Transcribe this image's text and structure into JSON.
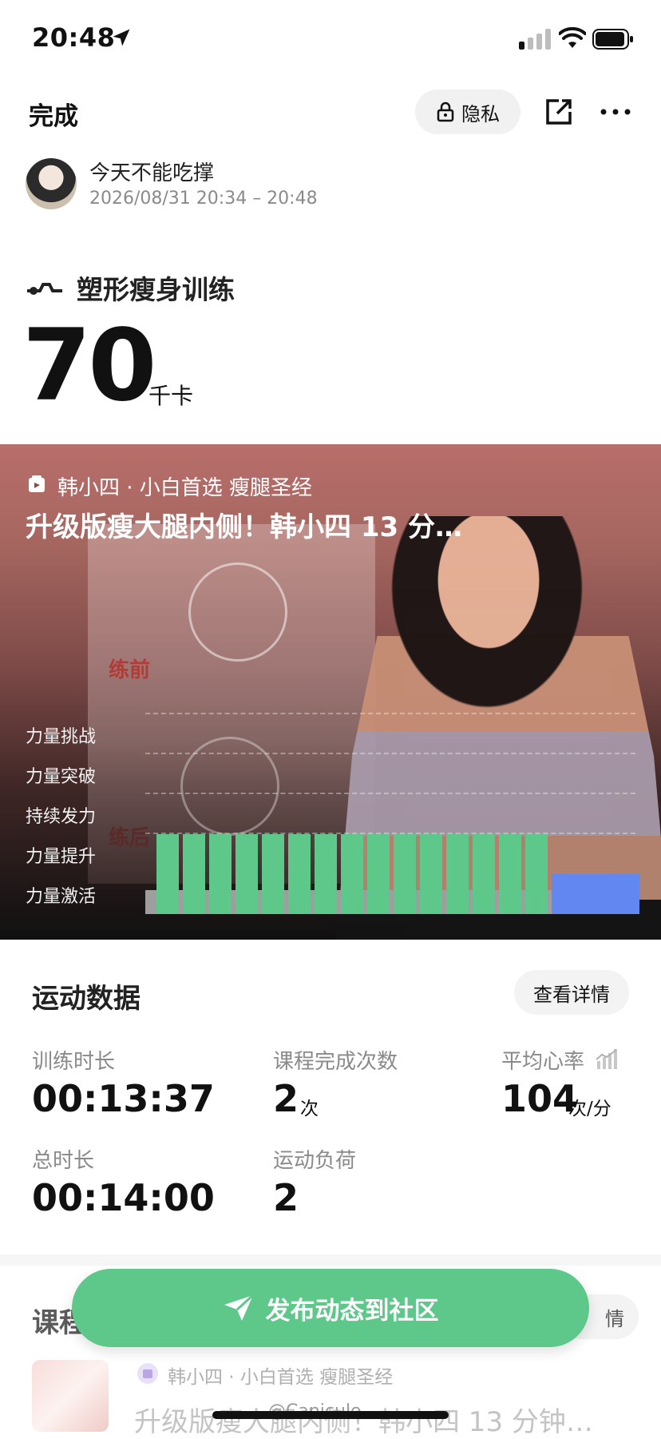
{
  "status_bar": {
    "time": "20:48"
  },
  "top_bar": {
    "done": "完成",
    "privacy": "隐私"
  },
  "user": {
    "name": "今天不能吃撑",
    "datetime": "2026/08/31 20:34 – 20:48"
  },
  "activity": {
    "name": "塑形瘦身训练",
    "calories": "70",
    "calories_unit": "千卡"
  },
  "course_card": {
    "meta": "韩小四 · 小白首选 瘦腿圣经",
    "title": "升级版瘦大腿内侧！韩小四 13 分…",
    "photo_text": {
      "before": "练前",
      "after": "练后"
    },
    "levels": [
      "力量挑战",
      "力量突破",
      "持续发力",
      "力量提升",
      "力量激活"
    ],
    "intensity": {
      "segments": [
        {
          "level": 2,
          "count": 15,
          "color": "#5ec78a"
        },
        {
          "level": 1,
          "count": 1,
          "color": "#6287f1"
        }
      ]
    }
  },
  "stats": {
    "title": "运动数据",
    "detail": "查看详情",
    "items": [
      {
        "label": "训练时长",
        "value": "00:13:37",
        "unit": ""
      },
      {
        "label": "课程完成次数",
        "value": "2",
        "unit": "次"
      },
      {
        "label": "平均心率",
        "value": "104",
        "unit": "次/分"
      },
      {
        "label": "总时长",
        "value": "00:14:00",
        "unit": ""
      },
      {
        "label": "运动负荷",
        "value": "2",
        "unit": ""
      }
    ]
  },
  "bottom": {
    "section_title": "课程",
    "detail": "情",
    "course_meta": "韩小四 · 小白首选 瘦腿圣经",
    "course_title": "升级版瘦大腿内侧！韩小四 13 分钟…",
    "publish": "发布动态到社区",
    "watermark": "@Canicule-"
  },
  "colors": {
    "accent_green": "#5ec78a",
    "accent_blue": "#6287f1"
  }
}
